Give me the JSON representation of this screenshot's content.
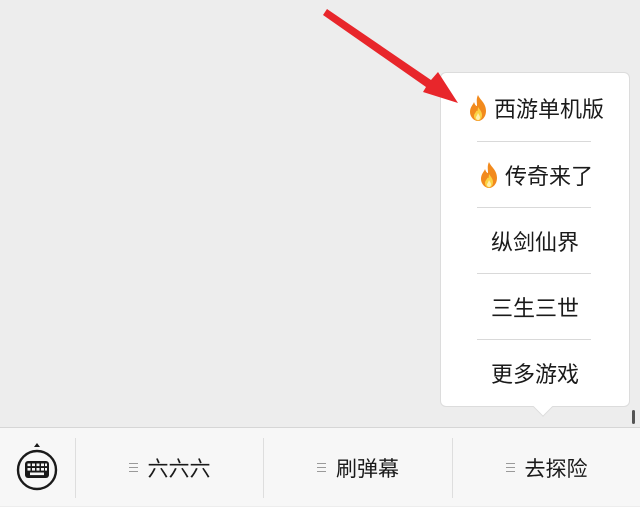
{
  "popup_menu": {
    "items": [
      {
        "label": "西游单机版",
        "icon": "fire-icon",
        "hot": true
      },
      {
        "label": "传奇来了",
        "icon": "fire-icon",
        "hot": true
      },
      {
        "label": "纵剑仙界",
        "hot": false
      },
      {
        "label": "三生三世",
        "hot": false
      },
      {
        "label": "更多游戏",
        "hot": false
      }
    ]
  },
  "bottom_bar": {
    "keyboard_icon": "keyboard-icon",
    "buttons": [
      {
        "label": "六六六",
        "icon": "menu-lines-icon"
      },
      {
        "label": "刷弹幕",
        "icon": "menu-lines-icon"
      },
      {
        "label": "去探险",
        "icon": "menu-lines-icon"
      }
    ]
  },
  "colors": {
    "background": "#ededed",
    "popup_bg": "#ffffff",
    "annotation_arrow": "#e8262b",
    "flame": "#f5871f"
  }
}
